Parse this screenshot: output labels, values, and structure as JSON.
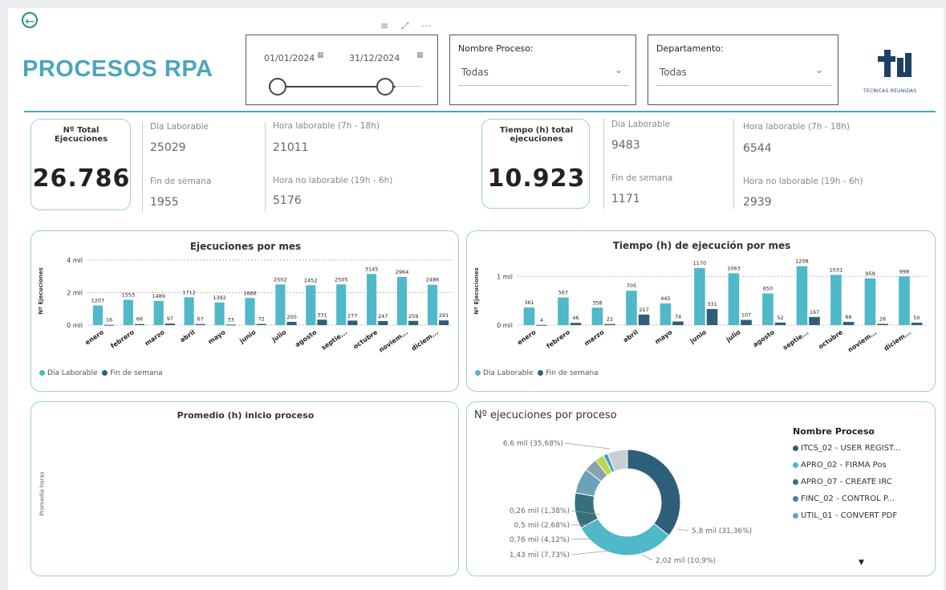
{
  "header": {
    "title": "PROCESOS RPA",
    "back_icon": "arrow-left-circle-icon",
    "toolbar_icons": "≡ ⤢ ⋯"
  },
  "date_slicer": {
    "start": "01/01/2024",
    "end": "31/12/2024"
  },
  "filters": {
    "proceso": {
      "label": "Nombre Proceso:",
      "value": "Todas"
    },
    "departamento": {
      "label": "Departamento:",
      "value": "Todas"
    }
  },
  "logo": {
    "mark": "TR",
    "text": "TECNICAS REUNIDAS"
  },
  "kpi_ejecuciones": {
    "label": "Nº Total Ejecuciones",
    "value": "26.786",
    "dia_laborable_label": "Día Laborable",
    "dia_laborable_value": "25029",
    "fin_semana_label": "Fin de semana",
    "fin_semana_value": "1955",
    "hora_lab_label": "Hora laborable (7h - 18h)",
    "hora_lab_value": "21011",
    "hora_nolab_label": "Hora no laborable (19h - 6h)",
    "hora_nolab_value": "5176"
  },
  "kpi_tiempo": {
    "label": "Tiempo (h) total ejecuciones",
    "value": "10.923",
    "dia_laborable_label": "Día Laborable",
    "dia_laborable_value": "9483",
    "fin_semana_label": "Fin de semana",
    "fin_semana_value": "1171",
    "hora_lab_label": "Hora laborable (7h - 18h)",
    "hora_lab_value": "6544",
    "hora_nolab_label": "Hora no laborable (19h - 6h)",
    "hora_nolab_value": "2939"
  },
  "colors": {
    "laborable": "#4fb8c9",
    "fin_semana": "#2e5f7a",
    "accent": "#4aa6bd"
  },
  "chart_data": [
    {
      "type": "bar",
      "title": "Ejecuciones por mes",
      "ylabel": "Nº Ejecuciones",
      "ytick_labels": [
        "0 mil",
        "2 mil",
        "4 mil"
      ],
      "yticks": [
        0,
        2000,
        4000
      ],
      "ylim": [
        0,
        4200
      ],
      "categories": [
        "enero",
        "febrero",
        "marzo",
        "abril",
        "mayo",
        "junio",
        "julio",
        "agosto",
        "septie...",
        "octubre",
        "noviem...",
        "diciem..."
      ],
      "series": [
        {
          "name": "Día Laborable",
          "values": [
            1207,
            1553,
            1489,
            1712,
            1392,
            1666,
            2502,
            2452,
            2505,
            3145,
            2964,
            2486
          ]
        },
        {
          "name": "Fin de semana",
          "values": [
            16,
            66,
            97,
            67,
            33,
            72,
            200,
            331,
            277,
            247,
            259,
            291
          ]
        }
      ],
      "legend": "bottom-left",
      "grid": true
    },
    {
      "type": "bar",
      "title": "Tiempo (h) de ejecución por mes",
      "ylabel": "Nº Ejecuciones",
      "ytick_labels": [
        "0 mil",
        "1 mil"
      ],
      "yticks": [
        0,
        1000
      ],
      "ylim": [
        0,
        1400
      ],
      "categories": [
        "enero",
        "febrero",
        "marzo",
        "abril",
        "mayo",
        "junio",
        "julio",
        "agosto",
        "septie...",
        "octubre",
        "noviem...",
        "diciem..."
      ],
      "series": [
        {
          "name": "Día Laborable",
          "values": [
            361,
            567,
            358,
            705,
            445,
            1170,
            1063,
            650,
            1208,
            1031,
            959,
            998
          ]
        },
        {
          "name": "Fin de semana",
          "values": [
            4,
            46,
            22,
            217,
            74,
            331,
            107,
            52,
            167,
            66,
            26,
            50
          ]
        }
      ],
      "legend": "bottom-left",
      "grid": true
    },
    {
      "type": "bar",
      "title": "Promedio (h) inicio proceso",
      "ylabel": "Promedio horas",
      "categories": [],
      "series": []
    },
    {
      "type": "pie",
      "title": "Nº ejecuciones por proceso",
      "legend_title": "Nombre Proceso",
      "slices": [
        {
          "label": "6,6 mil (35,68%)",
          "value": 35.68,
          "color": "#2e5f7a"
        },
        {
          "label": "5,8 mil (31,36%)",
          "value": 31.36,
          "color": "#4fb8c9"
        },
        {
          "label": "2,02 mil (10,9%)",
          "value": 10.9,
          "color": "#35707f"
        },
        {
          "label": "1,43 mil (7,73%)",
          "value": 7.73,
          "color": "#6aa3b8"
        },
        {
          "label": "0,76 mil (4,12%)",
          "value": 4.12,
          "color": "#8aa0ad"
        },
        {
          "label": "0,5 mil (2,68%)",
          "value": 2.68,
          "color": "#b9d64c"
        },
        {
          "label": "0,26 mil (1,38%)",
          "value": 1.38,
          "color": "#3f9fd0"
        },
        {
          "label": "",
          "value": 6.15,
          "color": "#c8d0d6"
        }
      ],
      "legend_items": [
        {
          "name": "ITCS_02 - USER REGIST...",
          "color": "#2e5f7a"
        },
        {
          "name": "APRO_02 - FIRMA Pos",
          "color": "#4fb8c9"
        },
        {
          "name": "APRO_07 - CREATE IRC",
          "color": "#35707f"
        },
        {
          "name": "FINC_02 - CONTROL P...",
          "color": "#4a7e95"
        },
        {
          "name": "UTIL_01 - CONVERT PDF",
          "color": "#6aa3b8"
        }
      ]
    }
  ]
}
